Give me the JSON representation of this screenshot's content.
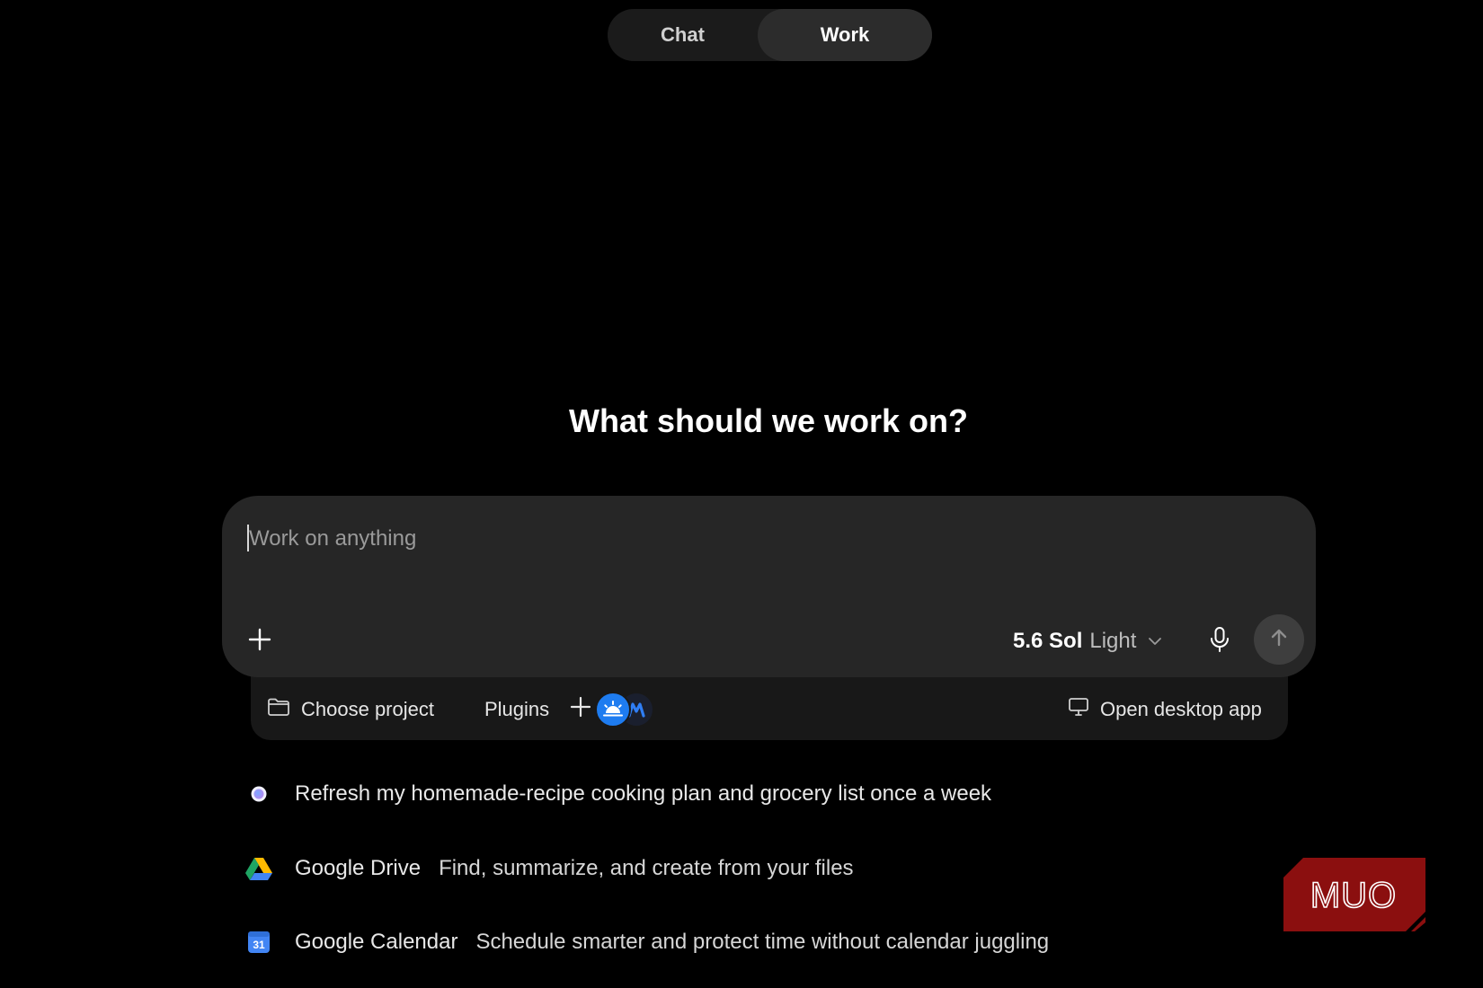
{
  "mode_toggle": {
    "chat_label": "Chat",
    "work_label": "Work",
    "active": "Work"
  },
  "heading": "What should we work on?",
  "composer": {
    "placeholder": "Work on anything",
    "model_name": "5.6 Sol",
    "model_variant": "Light"
  },
  "tray": {
    "project_label": "Choose project",
    "plugins_label": "Plugins",
    "desktop_label": "Open desktop app"
  },
  "suggestions": [
    {
      "icon": "scheduled-task-dot-icon",
      "title": "Refresh my homemade-recipe cooking plan and grocery list once a week",
      "description": ""
    },
    {
      "icon": "google-drive-icon",
      "title": "Google Drive",
      "description": "Find, summarize, and create from your files"
    },
    {
      "icon": "google-calendar-icon",
      "title": "Google Calendar",
      "description": "Schedule smarter and protect time without calendar juggling",
      "calendar_day": "31"
    }
  ],
  "watermark": "MUO",
  "colors": {
    "background": "#000000",
    "composer": "#262626",
    "tray": "#181818",
    "accent_blue": "#1e7cf0",
    "watermark_red": "#8b0f0f"
  }
}
